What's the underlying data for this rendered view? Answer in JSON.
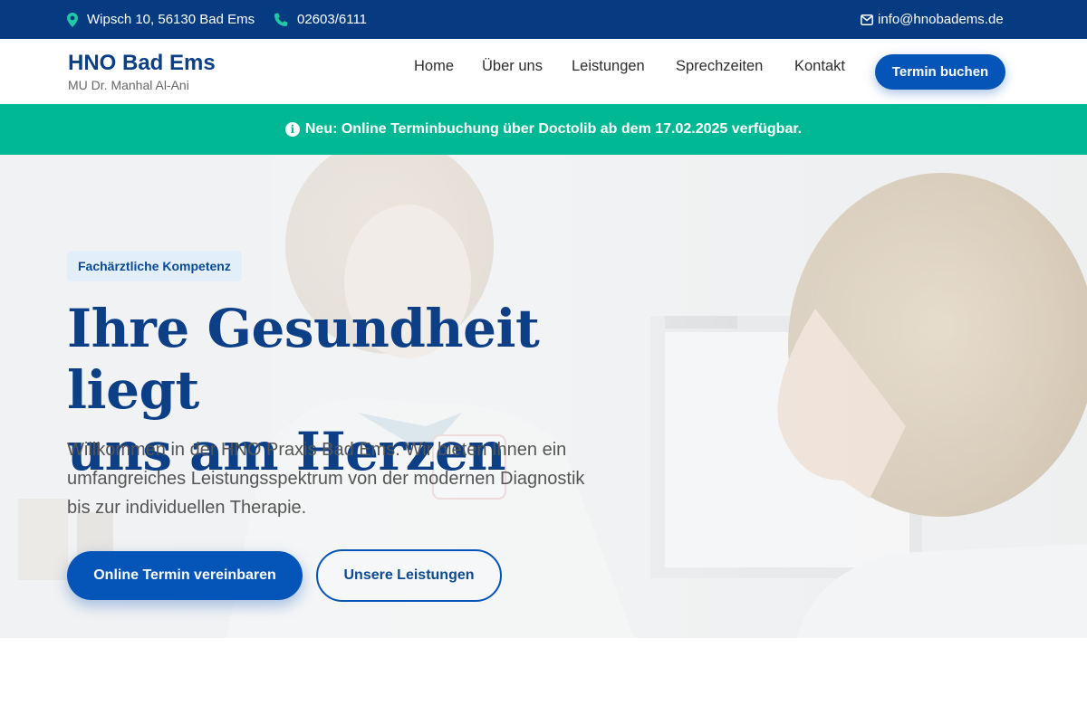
{
  "topbar": {
    "address": "Wipsch 10, 56130 Bad Ems",
    "phone": "02603/6111",
    "email": "info@hnobadems.de",
    "address_icon": "map-pin-icon",
    "phone_icon": "phone-icon",
    "email_icon": "envelope-icon"
  },
  "brand": {
    "title": "HNO Bad Ems",
    "subtitle": "MU Dr. Manhal Al-Ani"
  },
  "nav": {
    "items": [
      "Home",
      "Über uns",
      "Leistungen",
      "Sprechzeiten",
      "Kontakt"
    ],
    "cta": "Termin buchen"
  },
  "announcement": {
    "icon": "info-icon",
    "text": "Neu: Online Terminbuchung über Doctolib ab dem 17.02.2025 verfügbar."
  },
  "hero": {
    "badge": "Fachärztliche Kompetenz",
    "headline_line1": "Ihre Gesundheit liegt",
    "headline_line2": "uns am Herzen",
    "lead": "Willkommen in der HNO Praxis Bad Ems. Wir bieten Ihnen ein umfangreiches Leistungsspektrum von der modernen Diagnostik bis zur individuellen Therapie.",
    "primary_button": "Online Termin vereinbaren",
    "secondary_button": "Unsere Leistungen"
  },
  "colors": {
    "navy": "#063b82",
    "primary": "#0554b8",
    "accent_green": "#00b894",
    "heading": "#0c3f86"
  }
}
